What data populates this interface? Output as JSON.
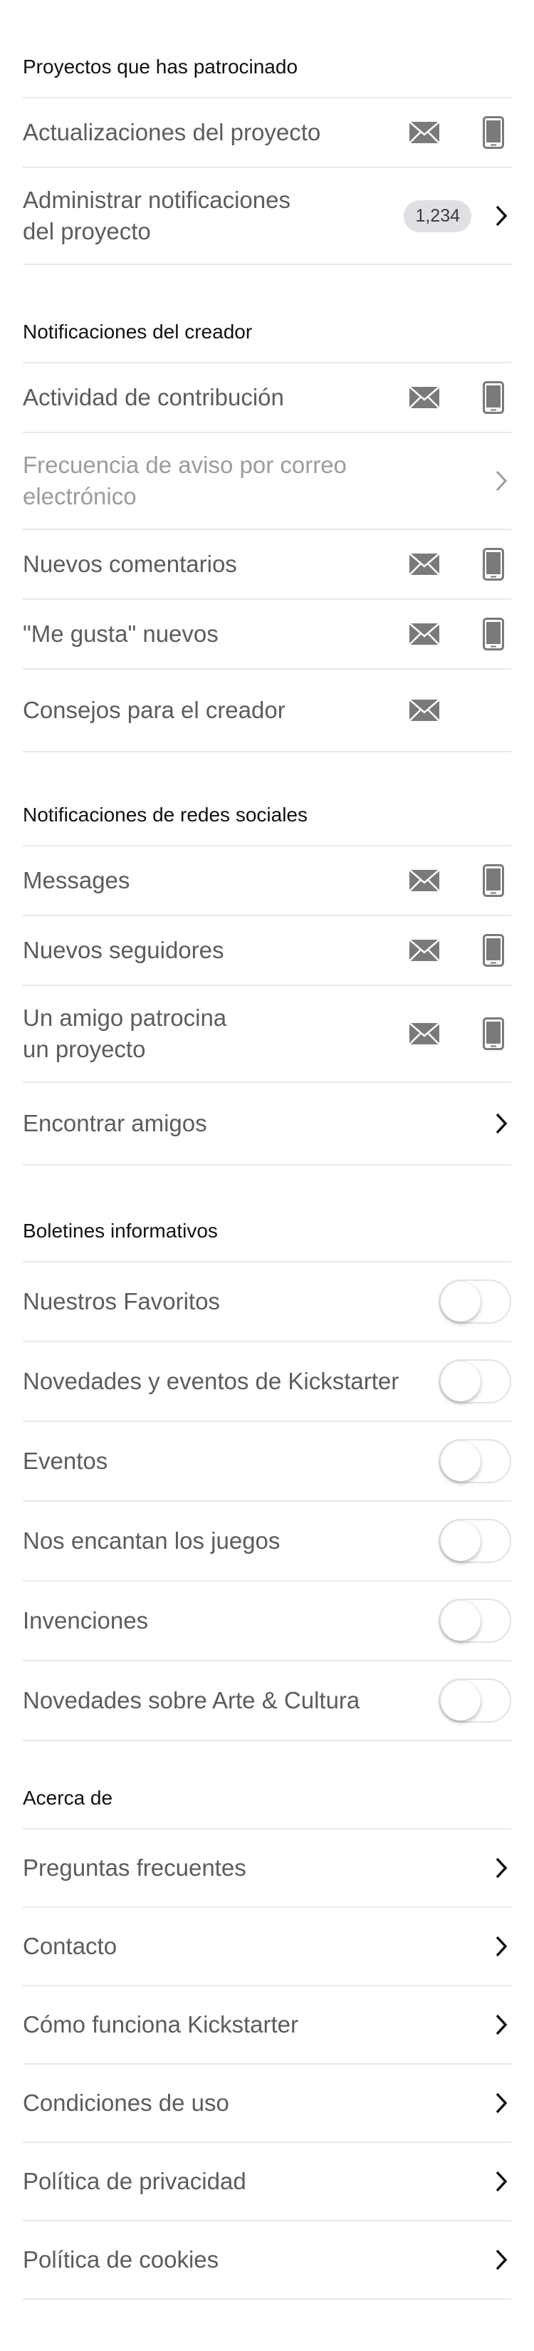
{
  "sections": {
    "backed": {
      "header": "Proyectos que has patrocinado",
      "rows": [
        {
          "label": "Actualizaciones del proyecto"
        },
        {
          "label": "Administrar notificaciones\ndel proyecto",
          "badge": "1,234"
        }
      ]
    },
    "creator": {
      "header": "Notificaciones del creador",
      "rows": [
        {
          "label": "Actividad de contribución"
        },
        {
          "label": "Frecuencia de aviso por correo\nelectrónico"
        },
        {
          "label": "Nuevos comentarios"
        },
        {
          "label": "\"Me gusta\" nuevos"
        },
        {
          "label": "Consejos para el creador"
        }
      ]
    },
    "social": {
      "header": "Notificaciones de redes sociales",
      "rows": [
        {
          "label": "Messages"
        },
        {
          "label": "Nuevos seguidores"
        },
        {
          "label": "Un amigo patrocina\nun proyecto"
        },
        {
          "label": "Encontrar amigos"
        }
      ]
    },
    "newsletters": {
      "header": "Boletines informativos",
      "rows": [
        {
          "label": "Nuestros Favoritos",
          "on": false
        },
        {
          "label": "Novedades y eventos de Kickstarter",
          "on": false
        },
        {
          "label": "Eventos",
          "on": false
        },
        {
          "label": "Nos encantan los juegos",
          "on": false
        },
        {
          "label": "Invenciones",
          "on": false
        },
        {
          "label": "Novedades sobre Arte & Cultura",
          "on": false
        }
      ]
    },
    "about": {
      "header": "Acerca de",
      "rows": [
        {
          "label": "Preguntas frecuentes"
        },
        {
          "label": "Contacto"
        },
        {
          "label": "Cómo funciona Kickstarter"
        },
        {
          "label": "Condiciones de uso"
        },
        {
          "label": "Política de privacidad"
        },
        {
          "label": "Política de cookies"
        }
      ]
    }
  },
  "colors": {
    "text": "#5c5c5c",
    "dim_text": "#9c9c9c",
    "icon": "#7a7a7a",
    "badge_bg": "#dfe0e4",
    "divider": "#e8e8e8"
  }
}
